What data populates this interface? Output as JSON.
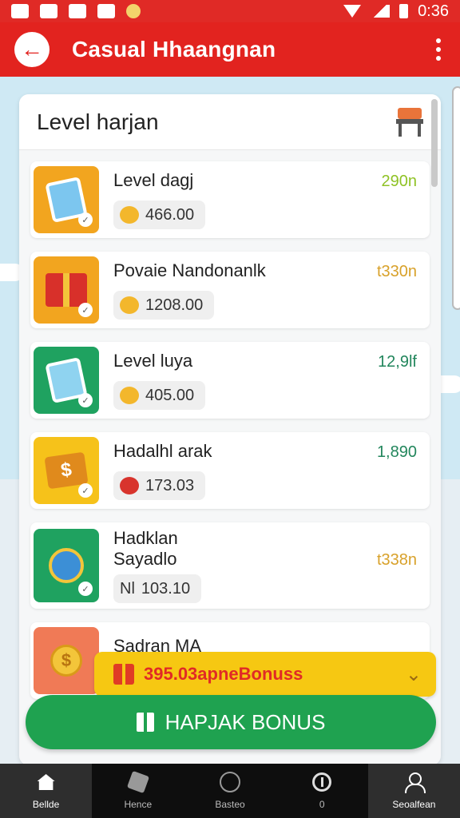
{
  "status_bar": {
    "time": "0:36"
  },
  "app_bar": {
    "title": "Casual Hhaangnan",
    "back_icon": "arrow-left-icon",
    "menu_icon": "more-vert-icon"
  },
  "panel": {
    "title": "Level harjan",
    "header_icon": "chair-icon",
    "items": [
      {
        "name": "Level dagj",
        "amount": "466.00",
        "value": "290n",
        "icon": "tablet-icon",
        "tile_color": "#f2a51f"
      },
      {
        "name": "Povaie Nandonanlk",
        "amount": "1208.00",
        "value": "t330n",
        "icon": "gift-box-icon",
        "tile_color": "#f2a51f"
      },
      {
        "name": "Level luya",
        "amount": "405.00",
        "value": "12,9lf",
        "icon": "card-icon",
        "tile_color": "#1fa260"
      },
      {
        "name": "Hadalhl arak",
        "amount": "173.03",
        "value": "1,890",
        "icon": "wallet-icon",
        "tile_color": "#f6c21a"
      },
      {
        "name_line1": "Hadklan",
        "name_line2": "Sayadlo",
        "prefix": "Nl",
        "amount": "103.10",
        "value": "t338n",
        "icon": "globe-trophy-icon",
        "tile_color": "#1fa260"
      },
      {
        "name": "Sadran MA",
        "icon": "coin-stack-icon",
        "tile_color": "#f07a56"
      }
    ]
  },
  "bonus_strip": {
    "text": "395.03apneBonuss",
    "chevron": "chevron-down-icon"
  },
  "cta": {
    "label": "HAPJAK BONUS"
  },
  "bottom_nav": [
    {
      "label": "Bellde",
      "icon": "home-icon"
    },
    {
      "label": "Hence",
      "icon": "box-icon"
    },
    {
      "label": "Basteo",
      "icon": "circle-icon"
    },
    {
      "label": "0",
      "icon": "timer-icon"
    },
    {
      "label": "Seoalfean",
      "icon": "profile-icon"
    }
  ]
}
